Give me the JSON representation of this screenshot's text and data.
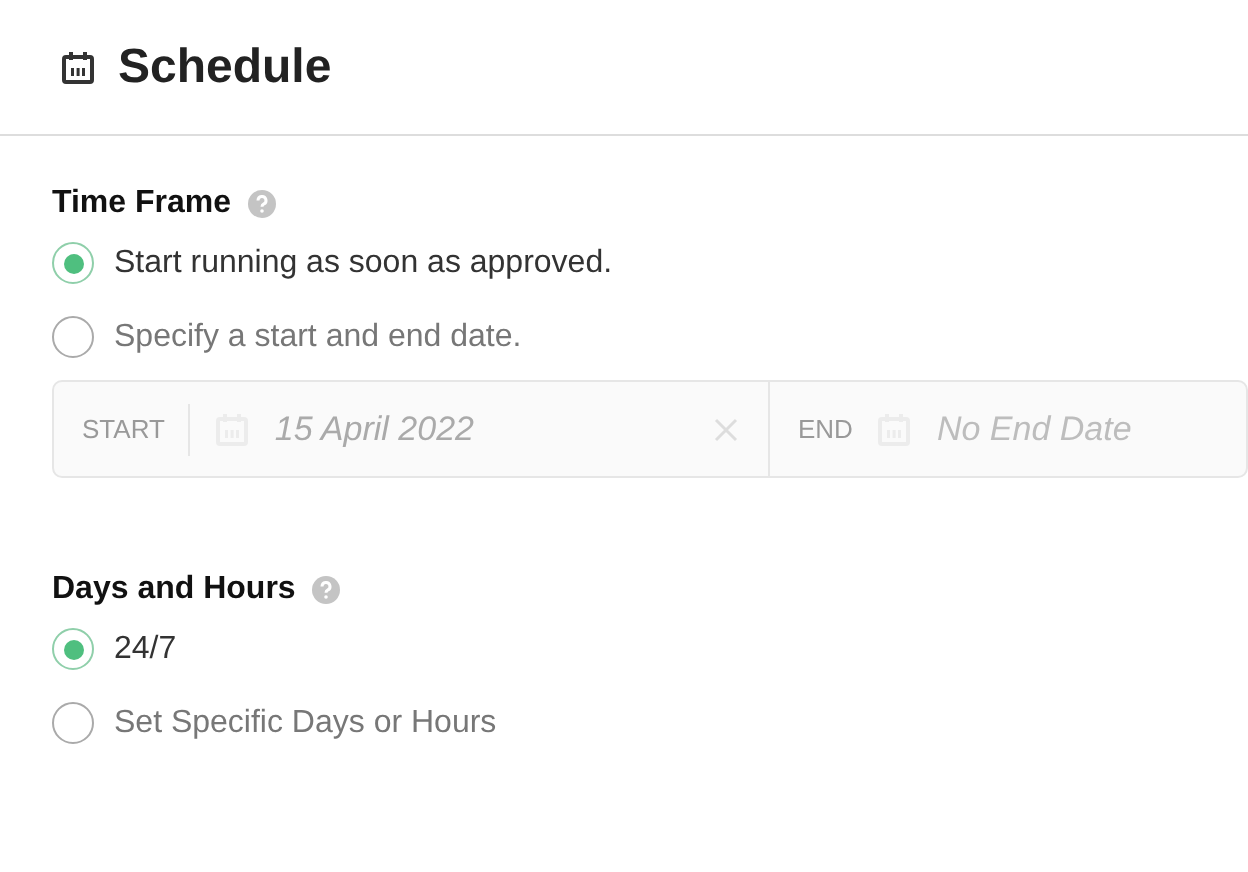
{
  "header": {
    "title": "Schedule"
  },
  "time_frame": {
    "title": "Time Frame",
    "options": [
      {
        "label": "Start running as soon as approved.",
        "selected": true
      },
      {
        "label": "Specify a start and end date.",
        "selected": false
      }
    ],
    "date_range": {
      "disabled": true,
      "start": {
        "label": "START",
        "value": "15 April 2022"
      },
      "end": {
        "label": "END",
        "placeholder": "No End Date"
      }
    }
  },
  "days_hours": {
    "title": "Days and Hours",
    "options": [
      {
        "label": "24/7",
        "selected": true
      },
      {
        "label": "Set Specific Days or Hours",
        "selected": false
      }
    ]
  }
}
